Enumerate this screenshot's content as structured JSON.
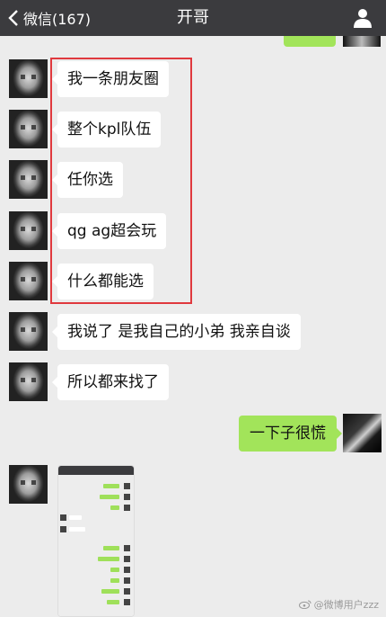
{
  "header": {
    "back_label": "微信(167)",
    "title": "开哥"
  },
  "messages": [
    {
      "side": "left",
      "text": "我一条朋友圈"
    },
    {
      "side": "left",
      "text": "整个kpl队伍"
    },
    {
      "side": "left",
      "text": "任你选"
    },
    {
      "side": "left",
      "text": "qg ag超会玩"
    },
    {
      "side": "left",
      "text": "什么都能选"
    },
    {
      "side": "left",
      "text": "我说了 是我自己的小弟 我亲自谈"
    },
    {
      "side": "left",
      "text": "所以都来找了"
    },
    {
      "side": "right",
      "text": "一下子很慌"
    }
  ],
  "watermark": "@微博用户zzz",
  "colors": {
    "topbar": "#3b3b3e",
    "background": "#ececec",
    "outgoing_bubble": "#a2e45a",
    "incoming_bubble": "#ffffff",
    "highlight_box": "#e0393e"
  }
}
